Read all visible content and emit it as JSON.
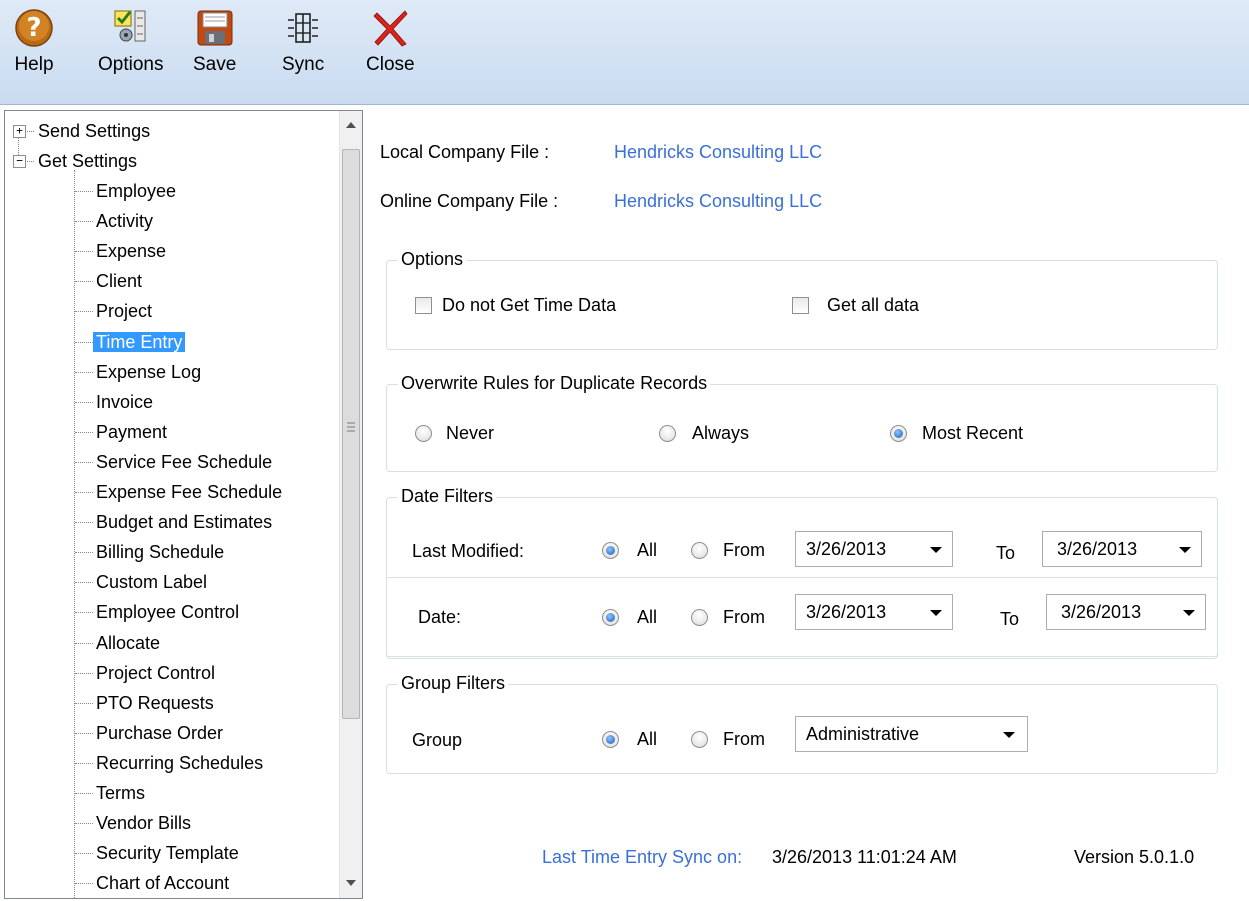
{
  "toolbar": {
    "help": "Help",
    "options": "Options",
    "save": "Save",
    "sync": "Sync",
    "close": "Close"
  },
  "tree": {
    "send_settings": "Send Settings",
    "get_settings": "Get Settings",
    "items": [
      "Employee",
      "Activity",
      "Expense",
      "Client",
      "Project",
      "Time Entry",
      "Expense Log",
      "Invoice",
      "Payment",
      "Service Fee Schedule",
      "Expense Fee Schedule",
      "Budget and Estimates",
      "Billing Schedule",
      "Custom Label",
      "Employee Control",
      "Allocate",
      "Project Control",
      "PTO Requests",
      "Purchase Order",
      "Recurring Schedules",
      "Terms",
      "Vendor Bills",
      "Security Template",
      "Chart of Account"
    ],
    "selected": "Time Entry"
  },
  "company": {
    "local_label": "Local Company File :",
    "local_value": "Hendricks Consulting LLC",
    "online_label": "Online Company File :",
    "online_value": "Hendricks Consulting LLC"
  },
  "options": {
    "title": "Options",
    "no_time_data": "Do not Get Time Data",
    "get_all": "Get all data"
  },
  "overwrite": {
    "title": "Overwrite Rules for Duplicate Records",
    "never": "Never",
    "always": "Always",
    "most_recent": "Most Recent"
  },
  "date_filters": {
    "title": "Date Filters",
    "last_modified": {
      "label": "Last Modified:",
      "all": "All",
      "from": "From",
      "from_date": "3/26/2013",
      "to": "To",
      "to_date": "3/26/2013"
    },
    "date": {
      "label": "Date:",
      "all": "All",
      "from": "From",
      "from_date": "3/26/2013",
      "to": "To",
      "to_date": "3/26/2013"
    }
  },
  "group_filters": {
    "title": "Group Filters",
    "label": "Group",
    "all": "All",
    "from": "From",
    "value": "Administrative"
  },
  "footer": {
    "last_sync_label": "Last Time Entry Sync on:",
    "last_sync_value": "3/26/2013 11:01:24 AM",
    "version": "Version 5.0.1.0"
  }
}
